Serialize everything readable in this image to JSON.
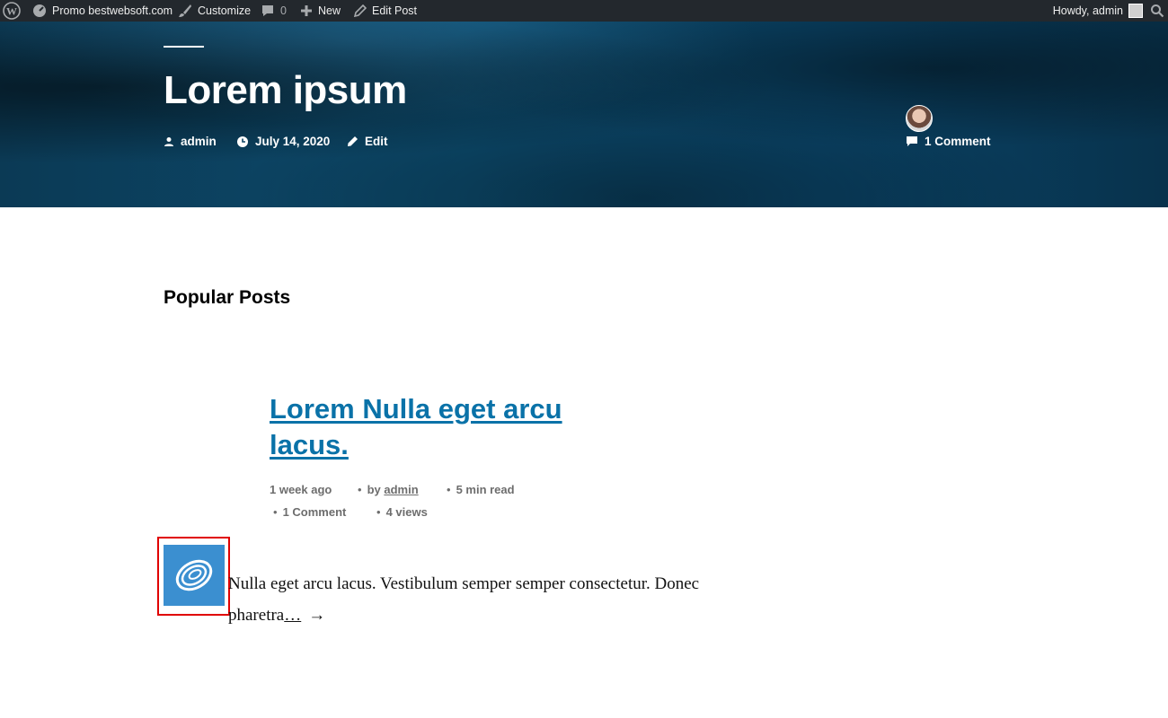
{
  "admin_bar": {
    "site_name": "Promo bestwebsoft.com",
    "customize": "Customize",
    "comments_count": "0",
    "new": "New",
    "edit_post": "Edit Post",
    "howdy": "Howdy, admin"
  },
  "hero": {
    "title": "Lorem ipsum",
    "author": "admin",
    "date": "July 14, 2020",
    "edit": "Edit",
    "comments": "1 Comment"
  },
  "popular_posts": {
    "heading": "Popular Posts",
    "post": {
      "title": "Lorem Nulla eget arcu lacus.",
      "time_ago": "1 week ago",
      "by": "by",
      "author": "admin",
      "read_time": "5 min read",
      "comments": "1 Comment",
      "views": "4 views",
      "excerpt": "Nulla eget arcu lacus. Vestibulum semper semper consectetur. Donec pharetra",
      "more": "…",
      "arrow": "→"
    }
  },
  "colors": {
    "admin_bar_bg": "#23282d",
    "link_blue": "#0a72a8",
    "thumb_blue": "#3b8fd0",
    "highlight_red": "#e00000"
  }
}
